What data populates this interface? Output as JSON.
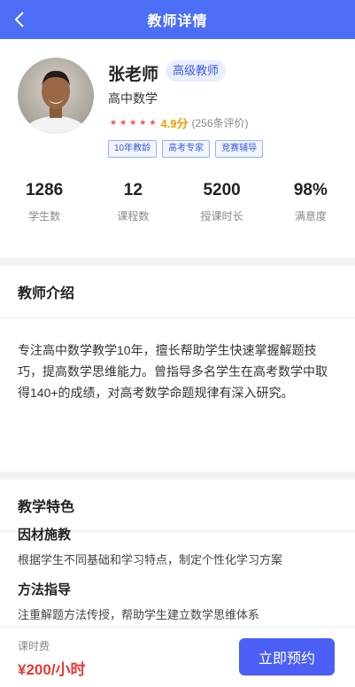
{
  "header": {
    "title": "教师详情",
    "back_icon": "chevron-left-icon"
  },
  "teacher": {
    "name": "张老师",
    "level": "高级教师",
    "subject": "高中数学",
    "stars": 5,
    "score": "4.9分",
    "reviews": "(256条评价)",
    "tags": [
      "10年教龄",
      "高考专家",
      "竞赛辅导"
    ]
  },
  "stats": [
    {
      "value": "1286",
      "label": "学生数"
    },
    {
      "value": "12",
      "label": "课程数"
    },
    {
      "value": "5200",
      "label": "授课时长"
    },
    {
      "value": "98%",
      "label": "满意度"
    }
  ],
  "intro": {
    "title": "教师介绍",
    "text": "专注高中数学教学10年，擅长帮助学生快速掌握解题技巧，提高数学思维能力。曾指导多名学生在高考数学中取得140+的成绩，对高考数学命题规律有深入研究。"
  },
  "features": {
    "title": "教学特色",
    "items": [
      {
        "title": "因材施教",
        "desc": "根据学生不同基础和学习特点，制定个性化学习方案"
      },
      {
        "title": "方法指导",
        "desc": "注重解题方法传授，帮助学生建立数学思维体系"
      }
    ]
  },
  "footer": {
    "fee_label": "课时费",
    "fee_value": "¥200/小时",
    "book_label": "立即预约"
  },
  "colors": {
    "primary": "#4b6ef5",
    "star": "#ff4d4f",
    "score": "#f59b00",
    "price": "#e53935"
  }
}
